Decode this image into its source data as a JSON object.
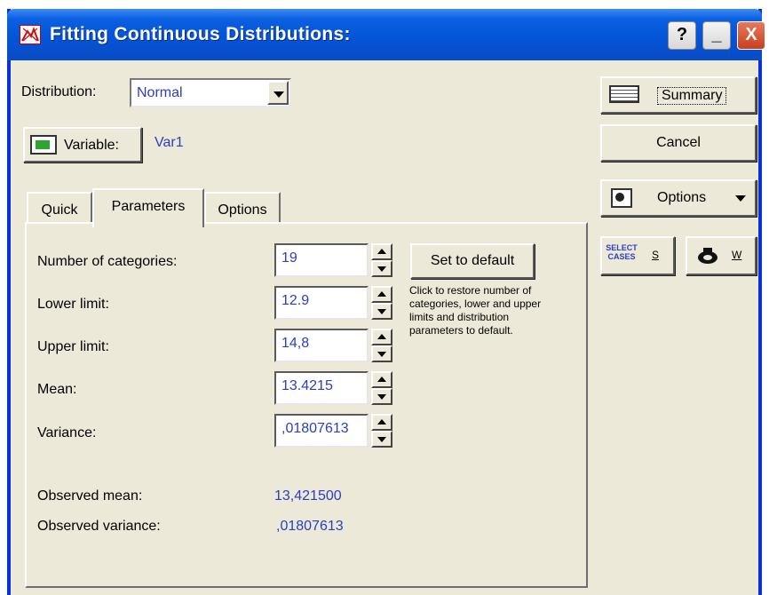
{
  "window": {
    "title": "Fitting Continuous Distributions:",
    "help_label": "?",
    "minimize_label": "_",
    "close_label": "X"
  },
  "distribution": {
    "label": "Distribution:",
    "value": "Normal"
  },
  "variable": {
    "button_label": "Variable:",
    "value": "Var1"
  },
  "tabs": [
    {
      "label": "Quick"
    },
    {
      "label": "Parameters",
      "active": true
    },
    {
      "label": "Options"
    }
  ],
  "parameters": {
    "number_of_categories": {
      "label": "Number of categories:",
      "value": "19"
    },
    "lower_limit": {
      "label": "Lower limit:",
      "value": "12.9"
    },
    "upper_limit": {
      "label": "Upper limit:",
      "value": "14,8"
    },
    "mean": {
      "label": "Mean:",
      "value": "13.4215"
    },
    "variance": {
      "label": "Variance:",
      "value": ",01807613"
    },
    "set_default_label": "Set to default",
    "set_default_note": "Click to restore number of categories, lower and upper limits and distribution parameters to default.",
    "observed_mean": {
      "label": "Observed mean:",
      "value": "13,421500"
    },
    "observed_variance": {
      "label": "Observed variance:",
      "value": ",01807613"
    }
  },
  "side_buttons": {
    "summary": "Summary",
    "cancel": "Cancel",
    "options": "Options",
    "select_cases_icon_text": "SELECT CASES",
    "select_cases_key": "S",
    "weight_key": "W"
  },
  "colors": {
    "titlebar": "#0453d6",
    "window_bg": "#ece9d8",
    "value_text": "#2a3ec4",
    "close_button": "#c8401e"
  }
}
